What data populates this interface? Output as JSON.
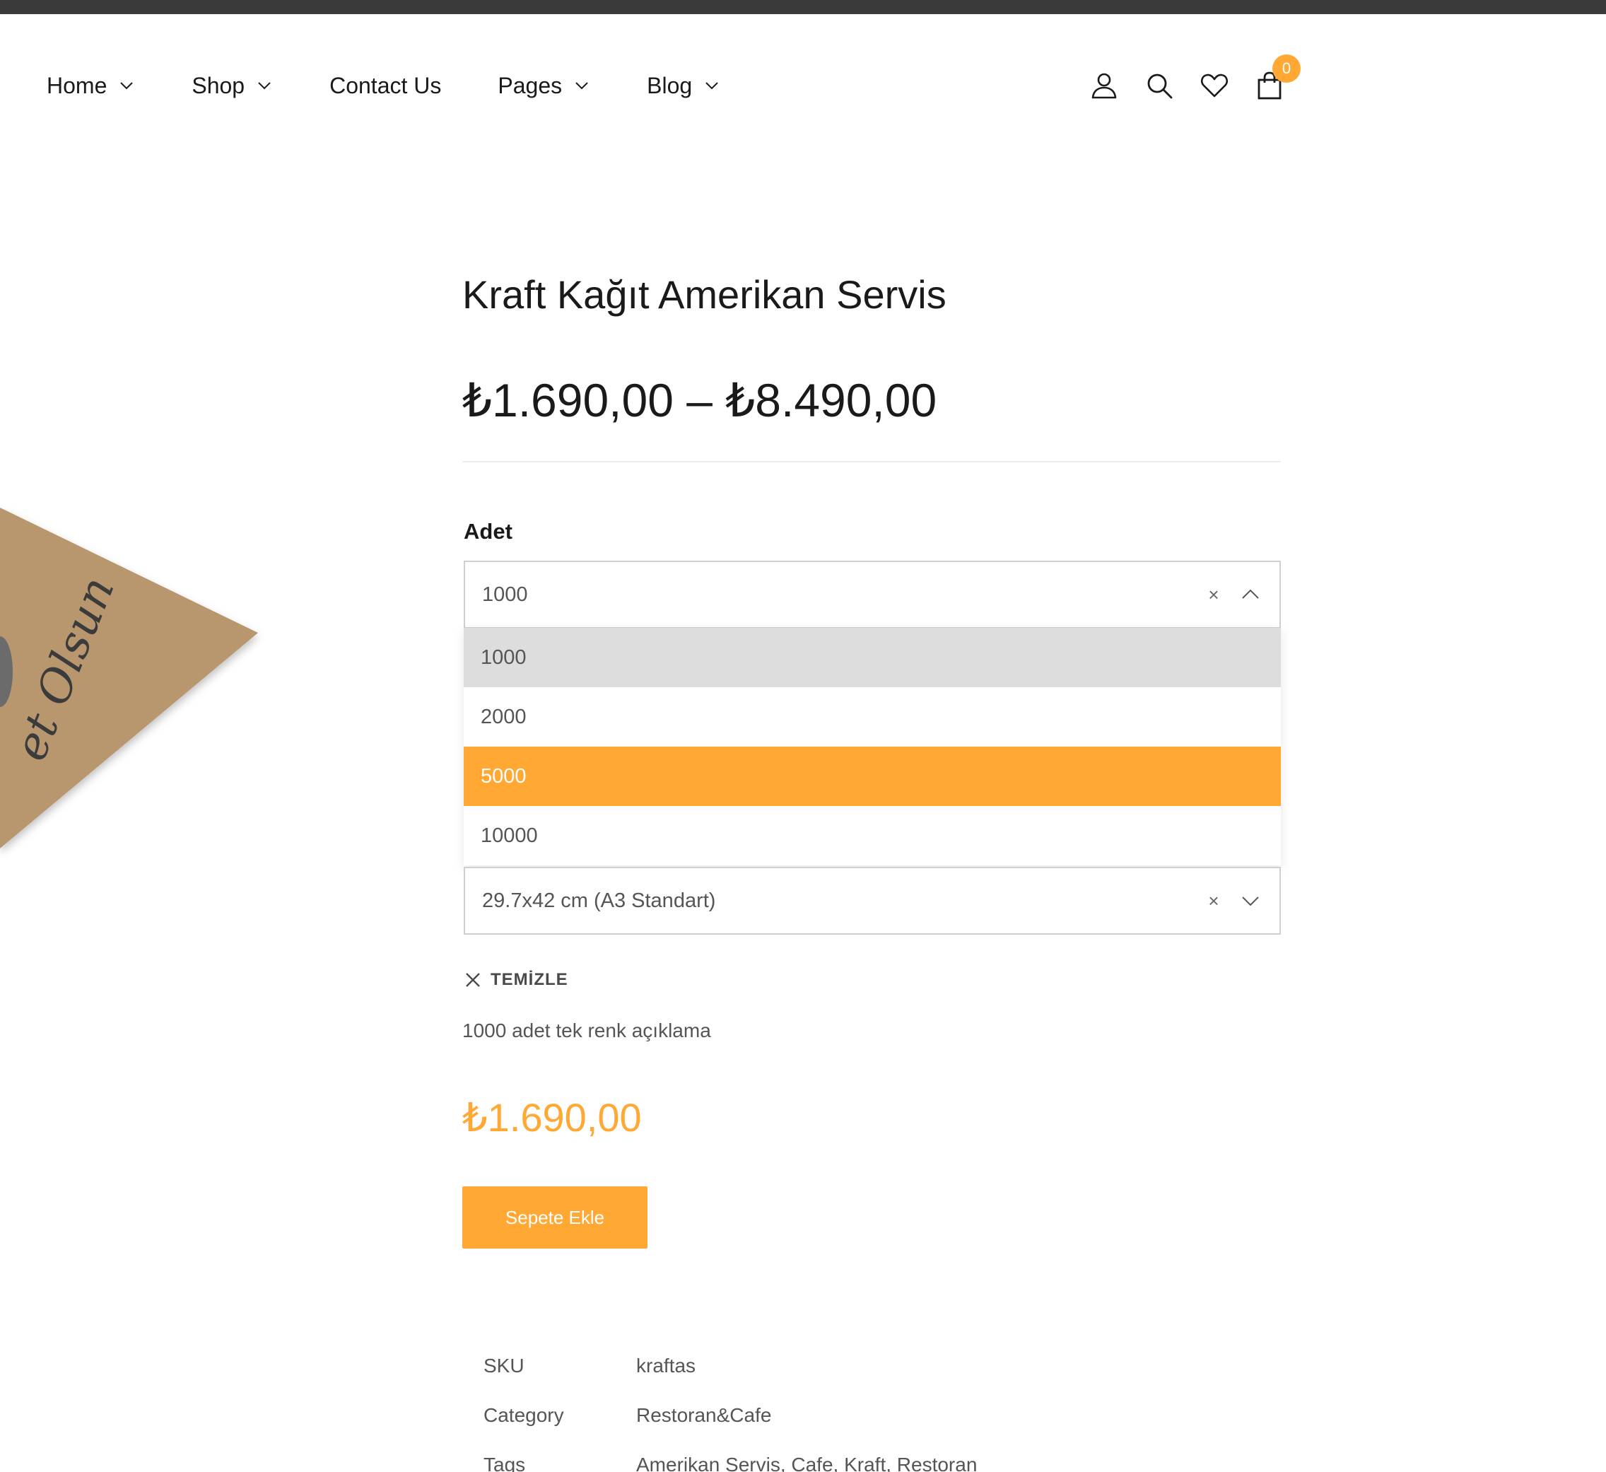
{
  "nav": {
    "items": [
      {
        "label": "Home",
        "has_dropdown": true
      },
      {
        "label": "Shop",
        "has_dropdown": true
      },
      {
        "label": "Contact Us",
        "has_dropdown": false
      },
      {
        "label": "Pages",
        "has_dropdown": true
      },
      {
        "label": "Blog",
        "has_dropdown": true
      }
    ]
  },
  "header_icons": {
    "account": "user-icon",
    "search": "search-icon",
    "wishlist": "heart-icon",
    "cart": "shopping-bag-icon",
    "cart_count": "0"
  },
  "product": {
    "image_text": "et Olsun",
    "title": "Kraft Kağıt Amerikan Servis",
    "price_range": "₺1.690,00 – ₺8.490,00",
    "attribute_label": "Adet",
    "quantity_select": {
      "value": "1000",
      "clear_symbol": "×",
      "state": "open",
      "options": [
        "1000",
        "2000",
        "5000",
        "10000"
      ],
      "selected_index": 0,
      "highlighted_index": 2
    },
    "size_select": {
      "value": "29.7x42 cm (A3 Standart)",
      "clear_symbol": "×",
      "state": "closed"
    },
    "clear_label": "TEMİZLE",
    "variation_description": "1000 adet tek renk açıklama",
    "variation_price": "₺1.690,00",
    "add_to_cart_label": "Sepete Ekle",
    "meta": {
      "sku_label": "SKU",
      "sku_value": "kraftas",
      "category_label": "Category",
      "category_value": "Restoran&Cafe",
      "tags_label": "Tags",
      "tags_value": "Amerikan Servis, Cafe, Kraft, Restoran"
    }
  },
  "colors": {
    "accent": "#ffa834",
    "top_bar": "#3a3a3a",
    "option_selected_bg": "#dddddd",
    "text_dark": "#1a1a1a",
    "text_muted": "#555555"
  }
}
